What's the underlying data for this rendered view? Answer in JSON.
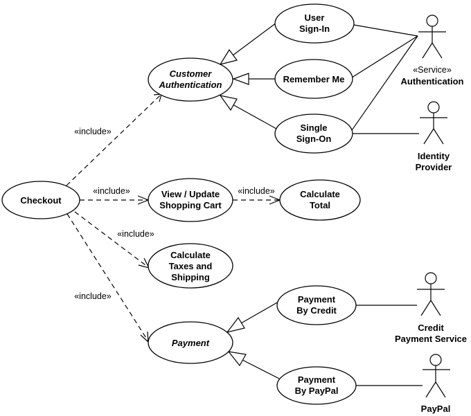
{
  "diagram": {
    "type": "UML use case diagram",
    "use_cases": [
      {
        "id": "user-sign-in",
        "lines": [
          "User",
          "Sign-In"
        ],
        "abstract": false
      },
      {
        "id": "customer-authentication",
        "lines": [
          "Customer",
          "Authentication"
        ],
        "abstract": true
      },
      {
        "id": "remember-me",
        "lines": [
          "Remember Me"
        ],
        "abstract": false
      },
      {
        "id": "single-sign-on",
        "lines": [
          "Single",
          "Sign-On"
        ],
        "abstract": false
      },
      {
        "id": "checkout",
        "lines": [
          "Checkout"
        ],
        "abstract": false
      },
      {
        "id": "view-update-shopping-cart",
        "lines": [
          "View / Update",
          "Shopping Cart"
        ],
        "abstract": false
      },
      {
        "id": "calculate-total",
        "lines": [
          "Calculate",
          "Total"
        ],
        "abstract": false
      },
      {
        "id": "calculate-taxes-and-shipping",
        "lines": [
          "Calculate",
          "Taxes and",
          "Shipping"
        ],
        "abstract": false
      },
      {
        "id": "payment",
        "lines": [
          "Payment"
        ],
        "abstract": true
      },
      {
        "id": "payment-by-credit",
        "lines": [
          "Payment",
          "By Credit"
        ],
        "abstract": false
      },
      {
        "id": "payment-by-paypal",
        "lines": [
          "Payment",
          "By PayPal"
        ],
        "abstract": false
      }
    ],
    "actors": [
      {
        "id": "authentication",
        "stereotype": "«Service»",
        "lines": [
          "Authentication"
        ]
      },
      {
        "id": "identity-provider",
        "stereotype": "",
        "lines": [
          "Identity",
          "Provider"
        ]
      },
      {
        "id": "credit-payment-service",
        "stereotype": "",
        "lines": [
          "Credit",
          "Payment Service"
        ]
      },
      {
        "id": "paypal",
        "stereotype": "",
        "lines": [
          "PayPal"
        ]
      }
    ],
    "include_label": "«include»",
    "relationships": {
      "include": [
        {
          "from": "checkout",
          "to": "customer-authentication",
          "label": "«include»"
        },
        {
          "from": "checkout",
          "to": "view-update-shopping-cart",
          "label": "«include»"
        },
        {
          "from": "checkout",
          "to": "calculate-taxes-and-shipping",
          "label": "«include»"
        },
        {
          "from": "checkout",
          "to": "payment",
          "label": "«include»"
        },
        {
          "from": "view-update-shopping-cart",
          "to": "calculate-total",
          "label": "«include»"
        }
      ],
      "generalization": [
        {
          "child": "user-sign-in",
          "parent": "customer-authentication"
        },
        {
          "child": "remember-me",
          "parent": "customer-authentication"
        },
        {
          "child": "single-sign-on",
          "parent": "customer-authentication"
        },
        {
          "child": "payment-by-credit",
          "parent": "payment"
        },
        {
          "child": "payment-by-paypal",
          "parent": "payment"
        }
      ],
      "association": [
        {
          "actor": "authentication",
          "use_case": "user-sign-in"
        },
        {
          "actor": "authentication",
          "use_case": "remember-me"
        },
        {
          "actor": "authentication",
          "use_case": "single-sign-on"
        },
        {
          "actor": "identity-provider",
          "use_case": "single-sign-on"
        },
        {
          "actor": "credit-payment-service",
          "use_case": "payment-by-credit"
        },
        {
          "actor": "paypal",
          "use_case": "payment-by-paypal"
        }
      ]
    }
  }
}
